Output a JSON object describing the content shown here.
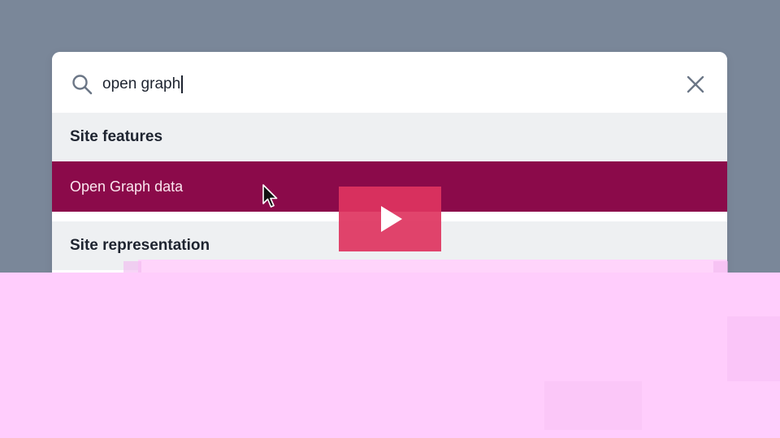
{
  "search": {
    "query": "open graph"
  },
  "sections": [
    {
      "heading": "Site features",
      "items": [
        {
          "label": "Open Graph data",
          "highlighted": true
        }
      ]
    },
    {
      "heading": "Site representation",
      "items": []
    }
  ],
  "icons": {
    "search": "search-icon",
    "close": "close-icon",
    "cursor": "mouse-pointer-icon",
    "play": "play-icon"
  },
  "colors": {
    "backdrop": "#7a8799",
    "highlight": "#8b0a4a",
    "section_bg": "#eef0f2",
    "play_button": "#de3460",
    "overlay": "#ffcdfc"
  }
}
